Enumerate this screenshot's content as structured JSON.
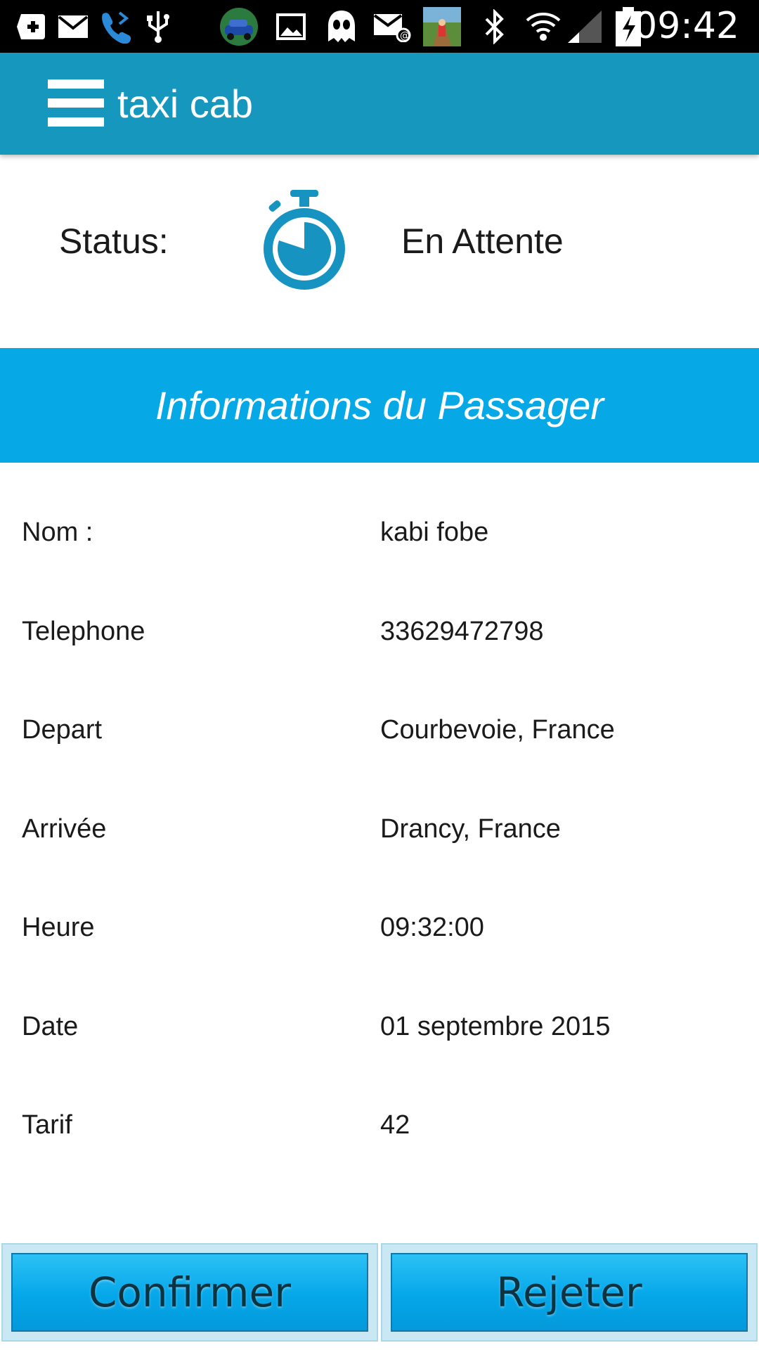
{
  "status_bar": {
    "time": "09:42",
    "icons": [
      "add-box-icon",
      "mail-icon",
      "phone-forward-icon",
      "usb-icon",
      "app-thumbnail-icon",
      "image-icon",
      "ghost-app-icon",
      "email-alert-icon",
      "game-thumbnail-icon",
      "bluetooth-icon",
      "wifi-icon",
      "signal-icon",
      "battery-charging-icon"
    ]
  },
  "app_bar": {
    "title": "taxi cab",
    "menu_icon": "hamburger-menu-icon"
  },
  "status": {
    "label": "Status:",
    "icon": "stopwatch-icon",
    "value": "En Attente"
  },
  "section": {
    "title": "Informations du Passager"
  },
  "passenger": {
    "rows": [
      {
        "label": "Nom :",
        "value": "kabi fobe"
      },
      {
        "label": "Telephone",
        "value": "33629472798"
      },
      {
        "label": "Depart",
        "value": "Courbevoie, France"
      },
      {
        "label": "Arrivée",
        "value": "Drancy, France"
      },
      {
        "label": "Heure",
        "value": "09:32:00"
      },
      {
        "label": "Date",
        "value": "01 septembre 2015"
      },
      {
        "label": "Tarif",
        "value": "42"
      }
    ]
  },
  "actions": {
    "confirm_label": "Confirmer",
    "reject_label": "Rejeter"
  },
  "colors": {
    "app_bar": "#1697bd",
    "section_header": "#06a8e6",
    "stopwatch": "#1693c0",
    "button": "#05a7e9",
    "button_text": "#0d3240"
  }
}
